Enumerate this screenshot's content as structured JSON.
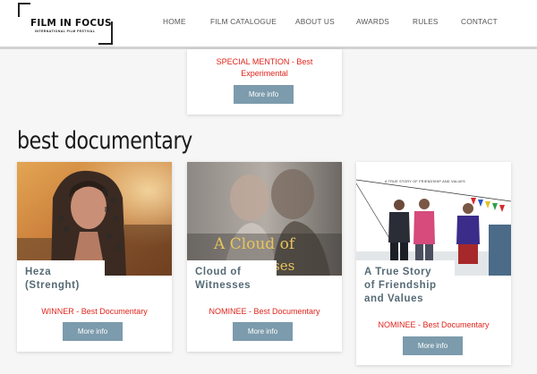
{
  "header": {
    "logo_title": "FILM IN FOCUS",
    "logo_subtitle": "INTERNATIONAL FILM FESTIVAL",
    "nav": [
      "HOME",
      "FILM CATALOGUE",
      "ABOUT US",
      "AWARDS",
      "RULES",
      "CONTACT"
    ]
  },
  "top_card": {
    "award_line1": "SPECIAL MENTION - Best",
    "award_line2": "Experimental",
    "button_label": "More info"
  },
  "section": {
    "title": "best documentary"
  },
  "films": [
    {
      "title_line1": "Heza",
      "title_line2": "(Strenght)",
      "award": "WINNER - Best Documentary",
      "button_label": "More info"
    },
    {
      "title_line1": "Cloud of",
      "title_line2": "Witnesses",
      "poster_text": "A Cloud of",
      "poster_text_faded": "ses",
      "award": "NOMINEE - Best Documentary",
      "button_label": "More info"
    },
    {
      "title_line1": "A True Story",
      "title_line2": "of Friendship",
      "title_line3": "and Values",
      "poster_caption": "A TRUE STORY OF FRIENDSHIP AND VALUES",
      "award": "NOMINEE - Best Documentary",
      "button_label": "More info"
    }
  ],
  "colors": {
    "award_red": "#e0241b",
    "button_blue_gray": "#7c9bac",
    "title_slate": "#566a75"
  }
}
